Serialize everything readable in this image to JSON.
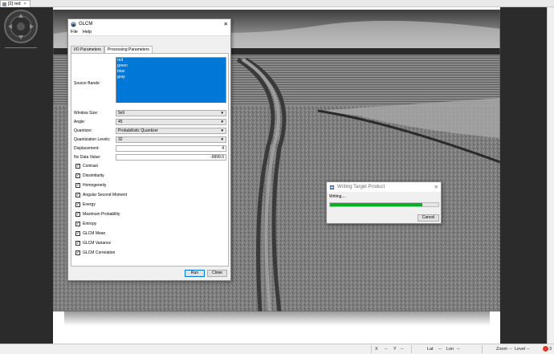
{
  "app": {
    "doc_tab": {
      "label": "[2] red",
      "close": "×"
    }
  },
  "glcm_dialog": {
    "title": "GLCM",
    "close": "✕",
    "menu": [
      "File",
      "Help"
    ],
    "tabs": [
      "I/O Parameters",
      "Processing Parameters"
    ],
    "active_tab": "Processing Parameters",
    "source_bands": {
      "label": "Source Bands:",
      "items": [
        "red",
        "green",
        "blue",
        "gray"
      ]
    },
    "window_size": {
      "label": "Window Size:",
      "value": "9x9"
    },
    "angle": {
      "label": "Angle:",
      "value": "45"
    },
    "quantizer": {
      "label": "Quantizer:",
      "value": "Probabilistic Quantizer"
    },
    "quantization_levels": {
      "label": "Quantization Levels:",
      "value": "32"
    },
    "displacement": {
      "label": "Displacement:",
      "value": "4"
    },
    "no_data_value": {
      "label": "No Data Value:",
      "value": "-9999.0"
    },
    "features": [
      {
        "label": "Contrast",
        "checked": true
      },
      {
        "label": "Dissimilarity",
        "checked": true
      },
      {
        "label": "Homogeneity",
        "checked": true
      },
      {
        "label": "Angular Second Moment",
        "checked": true
      },
      {
        "label": "Energy",
        "checked": true
      },
      {
        "label": "Maximum Probability",
        "checked": true
      },
      {
        "label": "Entropy",
        "checked": true
      },
      {
        "label": "GLCM Mean",
        "checked": true
      },
      {
        "label": "GLCM Variance",
        "checked": true
      },
      {
        "label": "GLCM Correlation",
        "checked": true
      }
    ],
    "buttons": {
      "run": "Run",
      "close": "Close"
    }
  },
  "writing_dialog": {
    "title": "Writing Target Product",
    "close": "✕",
    "status": "Writing....",
    "progress": 0.85,
    "progress_color": "#06b025",
    "cancel": "Cancel"
  },
  "statusbar": {
    "x": "X",
    "x_val": "--",
    "y": "Y",
    "y_val": "--",
    "lat": "Lat",
    "lat_val": "--",
    "lon": "Lon",
    "lon_val": "--",
    "zoom": "Zoom",
    "zoom_val": "--",
    "level": "Level",
    "level_val": "--",
    "notifications": "3"
  },
  "colors": {
    "selection": "#0078d7",
    "dark_panel": "#2b2b2b"
  }
}
